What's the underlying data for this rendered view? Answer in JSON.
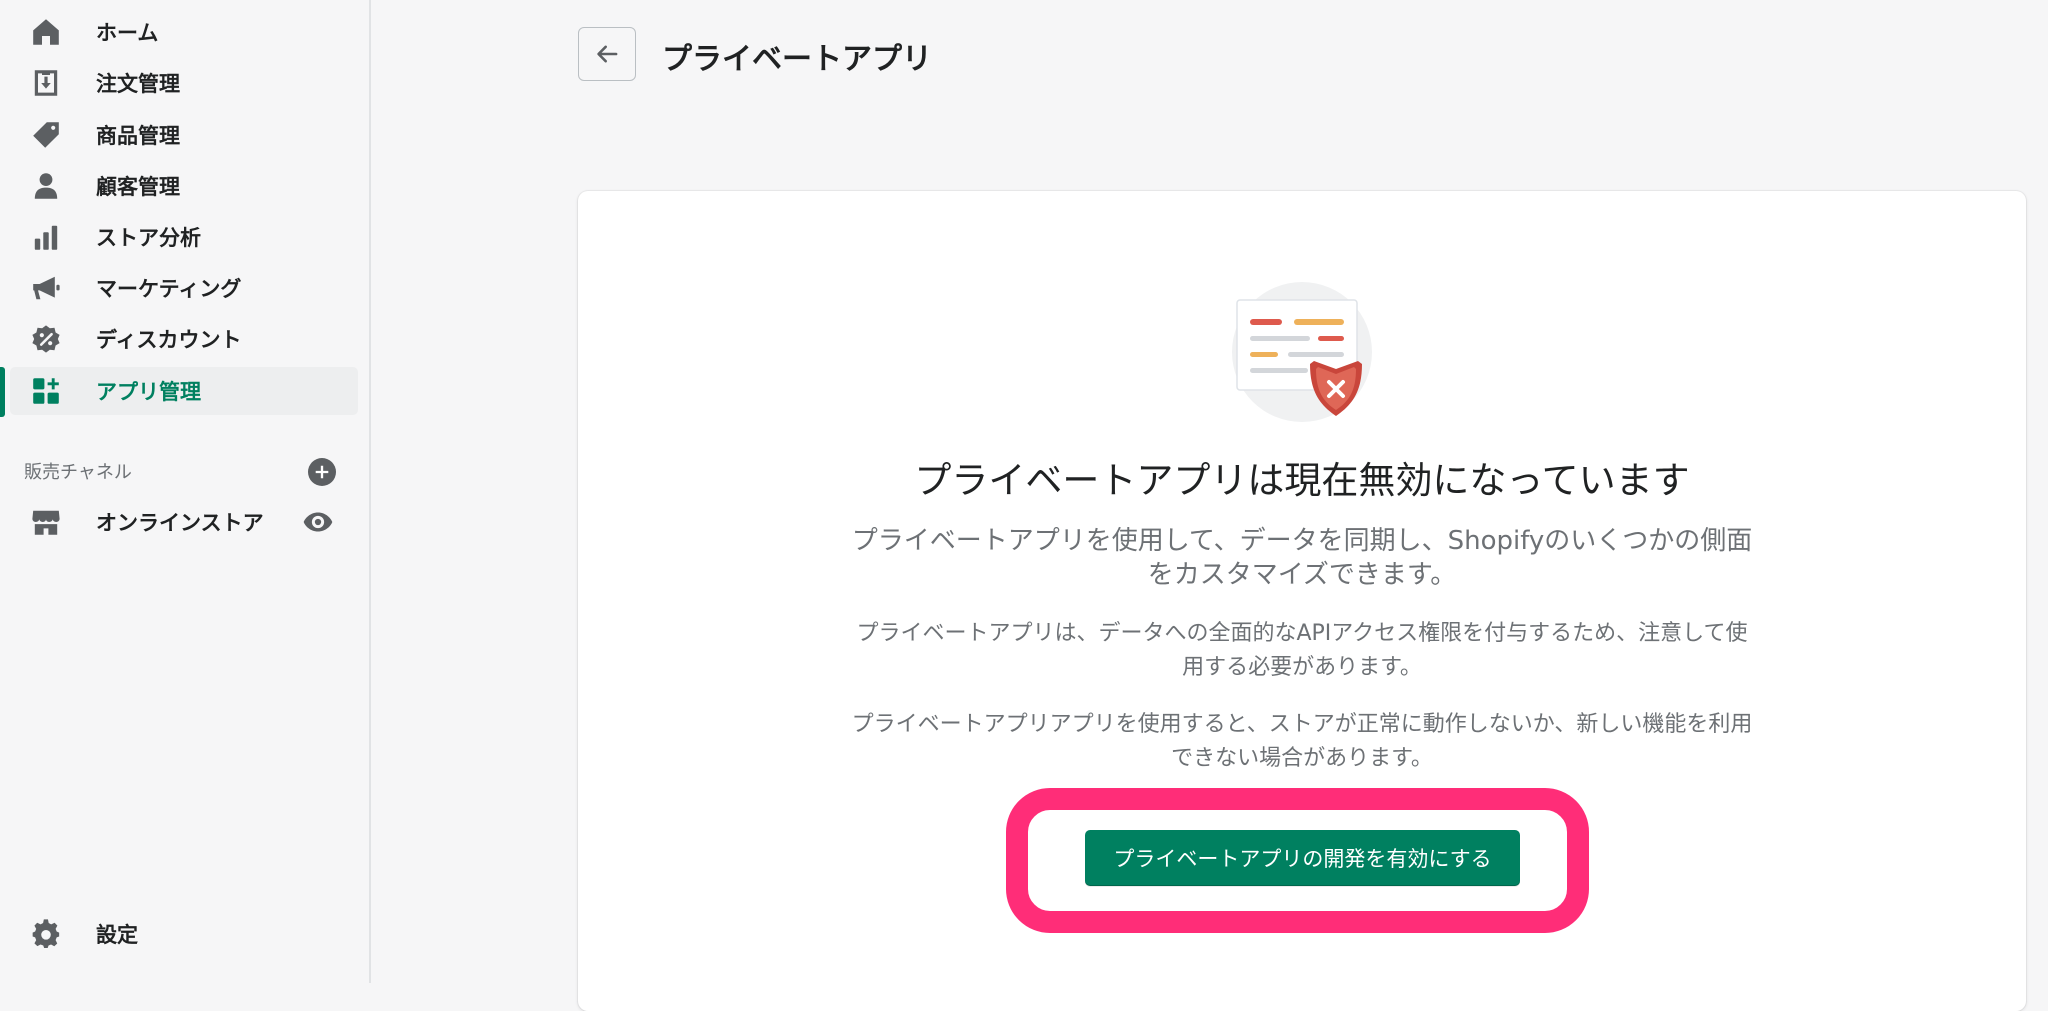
{
  "sidebar": {
    "items": [
      {
        "label": "ホーム",
        "icon": "home-icon"
      },
      {
        "label": "注文管理",
        "icon": "orders-icon"
      },
      {
        "label": "商品管理",
        "icon": "tag-icon"
      },
      {
        "label": "顧客管理",
        "icon": "customer-icon"
      },
      {
        "label": "ストア分析",
        "icon": "analytics-icon"
      },
      {
        "label": "マーケティング",
        "icon": "megaphone-icon"
      },
      {
        "label": "ディスカウント",
        "icon": "discount-icon"
      },
      {
        "label": "アプリ管理",
        "icon": "apps-icon",
        "active": true
      }
    ],
    "sales_channels_label": "販売チャネル",
    "online_store_label": "オンラインストア",
    "settings_label": "設定",
    "accent_color": "#008060"
  },
  "header": {
    "title": "プライベートアプリ"
  },
  "empty_state": {
    "heading": "プライベートアプリは現在無効になっています",
    "subheading": "プライベートアプリを使用して、データを同期し、Shopifyのいくつかの側面をカスタマイズできます。",
    "paragraph_1": "プライベートアプリは、データへの全面的なAPIアクセス権限を付与するため、注意して使用する必要があります。",
    "paragraph_2": "プライベートアプリアプリを使用すると、ストアが正常に動作しないか、新しい機能を利用できない場合があります。",
    "button_label": "プライベートアプリの開発を有効にする",
    "button_color": "#008060",
    "highlight_color": "#ff2d78"
  }
}
